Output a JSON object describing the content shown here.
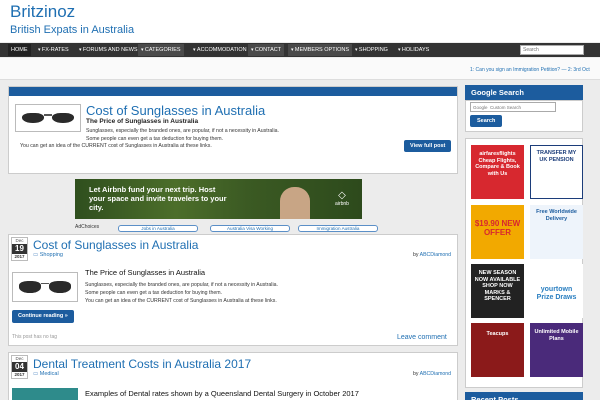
{
  "header": {
    "site_title": "Britzinoz",
    "site_description": "British Expats in Australia"
  },
  "nav": {
    "items": [
      {
        "label": "HOME"
      },
      {
        "label": "FX-RATES"
      },
      {
        "label": "FORUMS AND NEWS"
      },
      {
        "label": "CATEGORIES"
      },
      {
        "label": "ACCOMMODATION"
      },
      {
        "label": "CONTACT"
      },
      {
        "label": "MEMBERS OPTIONS"
      },
      {
        "label": "SHOPPING"
      },
      {
        "label": "HOLIDAYS"
      }
    ],
    "search_placeholder": "Search"
  },
  "ticker": {
    "text": "1: Can you sign an Immigration Petition? — 2: 3rd Oct"
  },
  "featured": {
    "title": "Cost of Sunglasses in Australia",
    "subtitle": "The Price of Sunglasses in Australia",
    "text_line1": "Sunglasses, especially the branded ones, are popular, if not a necessity in Australia.",
    "text_line2": "Some people can even get a tax deduction for buying them.",
    "text_line3": "You can get an idea of the CURRENT cost of Sunglasses in Australia at these links.",
    "button_label": "View full post"
  },
  "ad": {
    "headline": "Let Airbnb fund your next trip. Host your space and invite travelers to your city.",
    "brand": "airbnb",
    "adchoices": "AdChoices",
    "links": [
      "Jobs in Australia",
      "Australia Visa Working",
      "Immigration Australia"
    ]
  },
  "posts": [
    {
      "month": "Dec",
      "day": "19",
      "year": "2017",
      "title": "Cost of Sunglasses in Australia",
      "category": "Shopping",
      "author_prefix": "by",
      "author": "ABCDiamond",
      "subtitle": "The Price of Sunglasses in Australia",
      "text_line1": "Sunglasses, especially the branded ones, are popular, if not a necessity in Australia.",
      "text_line2": "Some people can even get a tax deduction for buying them.",
      "text_line3": "You can get an idea of the CURRENT cost of Sunglasses in Australia at these links.",
      "button_label": "Continue reading »",
      "footer": "This post has no tag",
      "comment_label": "Leave comment"
    },
    {
      "month": "Dec",
      "day": "04",
      "year": "2017",
      "title": "Dental Treatment Costs in Australia 2017",
      "category": "Medical",
      "author_prefix": "by",
      "author": "ABCDiamond",
      "subtitle": "Examples of Dental rates shown by a Queensland Dental Surgery in October 2017"
    }
  ],
  "sidebar": {
    "google_search": {
      "title": "Google Search",
      "placeholder": "Google  Custom Search",
      "button_label": "Search"
    },
    "ads": [
      {
        "text": "airfaresflights Cheap Flights, Compare & Book with Us"
      },
      {
        "text": "TRANSFER MY UK PENSION"
      },
      {
        "text": "$19.90 NEW OFFER"
      },
      {
        "text": "Free Worldwide Delivery"
      },
      {
        "text": "NEW SEASON NOW AVAILABLE SHOP NOW MARKS & SPENCER"
      },
      {
        "text": "yourtown Prize Draws"
      },
      {
        "text": "Teacups"
      },
      {
        "text": "Unlimited Mobile Plans"
      }
    ],
    "recent_posts_title": "Recent Posts"
  }
}
